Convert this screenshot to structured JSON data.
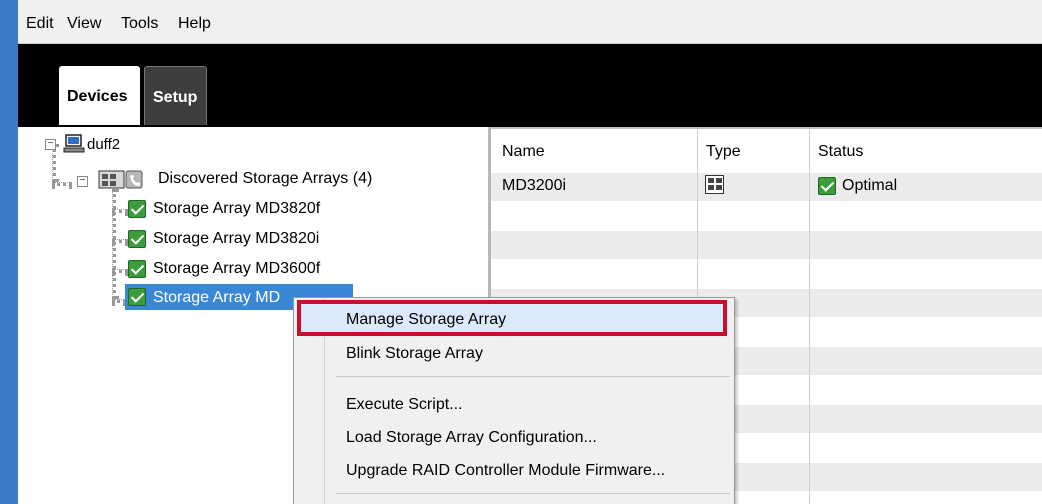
{
  "menubar": {
    "items": [
      "Edit",
      "View",
      "Tools",
      "Help"
    ]
  },
  "tabs": {
    "devices": "Devices",
    "setup": "Setup"
  },
  "tree": {
    "root": "duff2",
    "group": "Discovered Storage Arrays (4)",
    "arrays": [
      "Storage Array MD3820f",
      "Storage Array MD3820i",
      "Storage Array MD3600f",
      "Storage Array MD"
    ],
    "selected_index": 3
  },
  "grid": {
    "columns": [
      "Name",
      "Type",
      "Status"
    ],
    "rows": [
      {
        "name": "MD3200i",
        "type_icon": "storage-array-icon",
        "status": "Optimal"
      }
    ]
  },
  "context_menu": {
    "items": [
      "Manage Storage Array",
      "Blink Storage Array",
      "Execute Script...",
      "Load Storage Array Configuration...",
      "Upgrade RAID Controller Module Firmware..."
    ],
    "highlight_color": "#c8102e"
  },
  "colors": {
    "status_ok": "#3c9b3c",
    "selection": "#3a87d6",
    "window_accent": "#3a7bc8"
  },
  "icons": {
    "root": "computer-icon",
    "group": "storage-group-icon",
    "status": "check-icon"
  }
}
